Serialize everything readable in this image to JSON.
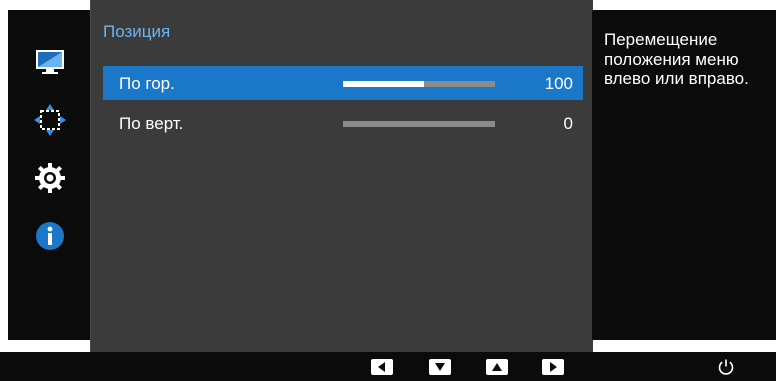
{
  "sidebar": {
    "icons": [
      {
        "name": "monitor-icon",
        "active": false
      },
      {
        "name": "position-arrows-icon",
        "active": true
      },
      {
        "name": "gear-icon",
        "active": false
      },
      {
        "name": "info-icon",
        "active": false
      }
    ]
  },
  "menu": {
    "title": "Позиция",
    "items": [
      {
        "label": "По гор.",
        "value": "100",
        "level": 0.53,
        "selected": true
      },
      {
        "label": "По верт.",
        "value": "0",
        "level": 0.0,
        "selected": false
      }
    ]
  },
  "help": {
    "text": "Перемещение положения меню влево или вправо."
  },
  "bottom_bar": {
    "keys": [
      "left-arrow-key",
      "down-arrow-key",
      "up-arrow-key",
      "right-arrow-key"
    ],
    "power": "power-icon"
  },
  "colors": {
    "accent": "#1b78c9",
    "title": "#6ab4f0",
    "panel": "#3b3b3b",
    "background": "#0b0b0b"
  }
}
